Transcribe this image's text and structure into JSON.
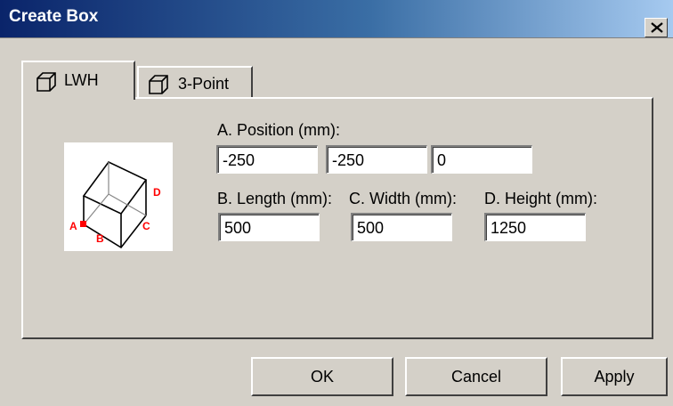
{
  "window": {
    "title": "Create Box",
    "close_icon": "close-icon"
  },
  "tabs": [
    {
      "label": "LWH",
      "icon": "box-icon",
      "active": true
    },
    {
      "label": "3-Point",
      "icon": "box-icon",
      "active": false
    }
  ],
  "preview": {
    "labels": {
      "a": "A",
      "b": "B",
      "c": "C",
      "d": "D"
    },
    "marker_color": "#ff0000"
  },
  "position": {
    "label": "A. Position (mm):",
    "x": "-250",
    "y": "-250",
    "z": "0"
  },
  "dimensions": {
    "length_label": "B. Length (mm):",
    "length": "500",
    "width_label": "C. Width (mm):",
    "width": "500",
    "height_label": "D. Height (mm):",
    "height": "1250"
  },
  "buttons": {
    "ok": "OK",
    "cancel": "Cancel",
    "apply": "Apply"
  }
}
